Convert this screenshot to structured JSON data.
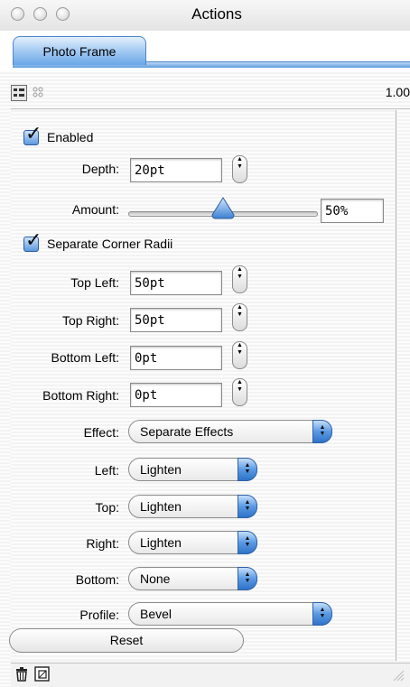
{
  "window": {
    "title": "Actions"
  },
  "tabs": [
    {
      "label": "Photo Frame",
      "selected": true
    }
  ],
  "toolbar": {
    "value": "1.00"
  },
  "panel": {
    "enabled": {
      "label": "Enabled",
      "checked": true
    },
    "depth": {
      "label": "Depth:",
      "value": "20pt"
    },
    "amount": {
      "label": "Amount:",
      "value": "50%",
      "fraction": 0.5
    },
    "separate_corner_radii": {
      "label": "Separate Corner Radii",
      "checked": true
    },
    "top_left": {
      "label": "Top Left:",
      "value": "50pt"
    },
    "top_right": {
      "label": "Top Right:",
      "value": "50pt"
    },
    "bottom_left": {
      "label": "Bottom Left:",
      "value": "0pt"
    },
    "bottom_right": {
      "label": "Bottom Right:",
      "value": "0pt"
    },
    "effect": {
      "label": "Effect:",
      "value": "Separate Effects"
    },
    "left": {
      "label": "Left:",
      "value": "Lighten"
    },
    "top": {
      "label": "Top:",
      "value": "Lighten"
    },
    "right": {
      "label": "Right:",
      "value": "Lighten"
    },
    "bottom": {
      "label": "Bottom:",
      "value": "None"
    },
    "profile": {
      "label": "Profile:",
      "value": "Bevel"
    },
    "reset_label": "Reset"
  },
  "colors": {
    "accent": "#5a9ae3",
    "tab_border": "#4a86cc"
  },
  "icons": [
    "close-icon",
    "minimize-icon",
    "zoom-icon",
    "list-view-icon",
    "grid-view-icon",
    "trash-icon",
    "new-action-icon"
  ]
}
